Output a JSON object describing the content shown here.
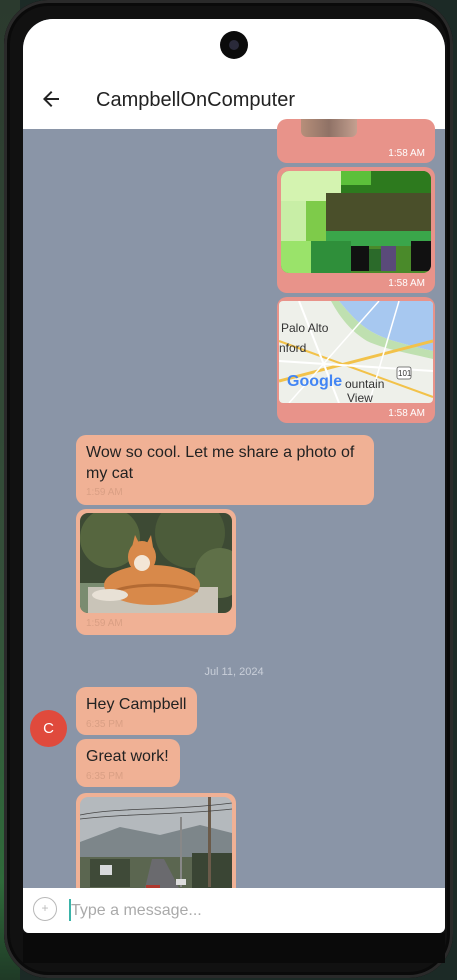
{
  "header": {
    "title": "CampbellOnComputer",
    "back_icon": "arrow-left-icon"
  },
  "messages": {
    "outgoing": [
      {
        "time": "1:58 AM",
        "kind": "image"
      },
      {
        "time": "1:58 AM",
        "kind": "pixel-image"
      },
      {
        "time": "1:58 AM",
        "kind": "map",
        "map_labels": {
          "palo_alto": "Palo Alto",
          "stanford": "nford",
          "mountain": "ountain",
          "view": "View",
          "route": "101",
          "google": "Google"
        }
      }
    ],
    "incoming_group1": [
      {
        "text": "Wow so cool. Let me share a photo of my cat",
        "time": "1:59 AM"
      },
      {
        "kind": "image",
        "time": "1:59 AM"
      }
    ],
    "date_separator": "Jul 11, 2024",
    "incoming_group2": [
      {
        "text": "Hey Campbell",
        "time": "6:35 PM"
      },
      {
        "text": "Great work!",
        "time": "6:35 PM"
      },
      {
        "kind": "image"
      }
    ],
    "avatar_initial": "C"
  },
  "composer": {
    "placeholder": "Type a message...",
    "add_symbol": "+"
  },
  "colors": {
    "background": "#8a95a7",
    "outgoing_bubble": "#e8938a",
    "incoming_bubble": "#f0b195",
    "avatar": "#e04a3c"
  }
}
